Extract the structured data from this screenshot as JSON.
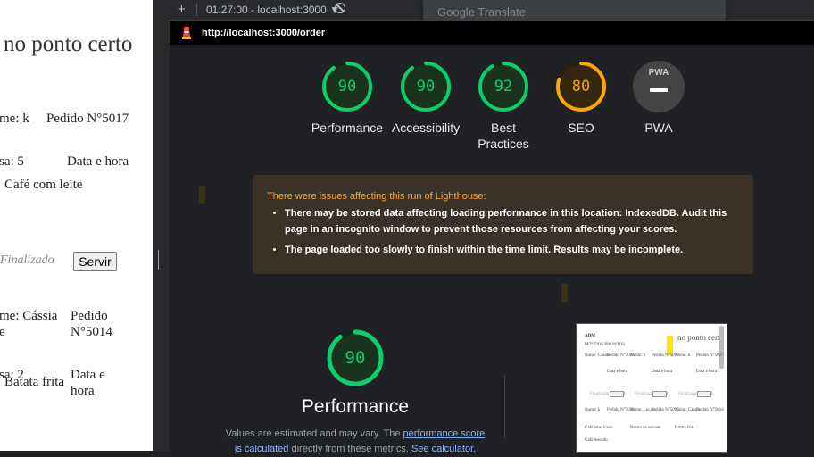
{
  "left_page": {
    "title": "no ponto certo",
    "order1": {
      "name": "me: k",
      "order_no": "Pedido N°5017",
      "table": "sa: 5",
      "datetime": "Data e hora",
      "item": "Café com leite",
      "status": "Finalizado",
      "button": "Servir"
    },
    "order2": {
      "name_l1": "me: Cássia",
      "name_l2": "e",
      "order_l1": "Pedido",
      "order_l2": "N°5014",
      "table": "sa: 2",
      "item": "Batata frita",
      "datetime_l1": "Data e",
      "datetime_l2": "hora"
    }
  },
  "topbar": {
    "new_tab_icon": "+",
    "time_host": "01:27:00 - localhost:3000 ▼"
  },
  "translate": {
    "label": "Google Translate"
  },
  "urlbar": {
    "url": "http://localhost:3000/order"
  },
  "scores": [
    {
      "label": "Performance",
      "value": "90",
      "fraction": 0.9,
      "color": "#0cce6b"
    },
    {
      "label": "Accessibility",
      "value": "90",
      "fraction": 0.9,
      "color": "#0cce6b"
    },
    {
      "label": "Best Practices",
      "value": "92",
      "fraction": 0.92,
      "color": "#0cce6b"
    },
    {
      "label": "SEO",
      "value": "80",
      "fraction": 0.8,
      "color": "#ffa400"
    }
  ],
  "pwa": {
    "label": "PWA",
    "badge": "PWA"
  },
  "warning": {
    "heading": "There were issues affecting this run of Lighthouse:",
    "items": [
      "There may be stored data affecting loading performance in this location: IndexedDB. Audit this page in an incognito window to prevent those resources from affecting your scores.",
      "The page loaded too slowly to finish within the time limit. Results may be incomplete."
    ]
  },
  "performance": {
    "score": "90",
    "fraction": 0.9,
    "title": "Performance",
    "desc_1": "Values are estimated and may vary. The ",
    "link_1": "performance score",
    "link_1b": "is calculated",
    "desc_2": " directly from these metrics. ",
    "link_2": "See calculator."
  },
  "thumbnail": {
    "title": "no ponto certo",
    "heading": "ADM",
    "sub": "PEDIDOS PRONTOS",
    "cells": [
      "Nome: Cássia",
      "Pedido N°5024",
      "Nome: k",
      "Pedido N°5017",
      "Nome: k",
      "Pedido N°5017",
      "Data e hora",
      "Data e hora",
      "Data e hora",
      "Finalizado",
      "Servir",
      "Finalizado",
      "Servir",
      "Finalizado",
      "Servir",
      "Nome: k",
      "Pedido N°5018",
      "Nome: Lucas",
      "Pedido N°5015",
      "Nome: Cássia",
      "Pedido N°5014",
      "Café americano",
      "Batata de sorvete",
      "Batata frita",
      "Café mexido"
    ]
  }
}
